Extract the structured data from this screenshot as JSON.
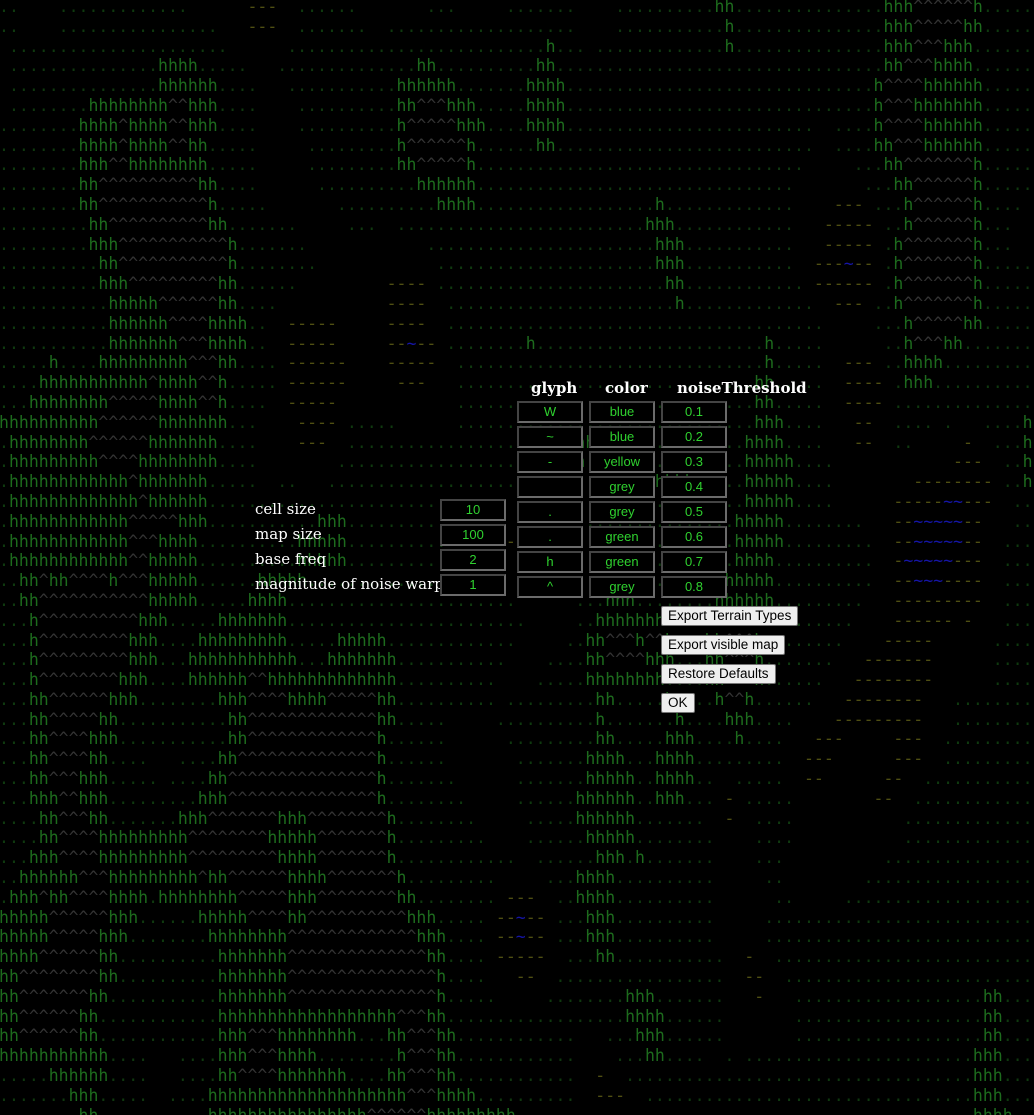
{
  "settings": {
    "cell_size": {
      "label": "cell size",
      "value": "10"
    },
    "map_size": {
      "label": "map size",
      "value": "100"
    },
    "base_freq": {
      "label": "base freq",
      "value": "2"
    },
    "noise_warping": {
      "label": "magnitude of noise warping",
      "value": "1"
    }
  },
  "terrain_table": {
    "headers": {
      "glyph": "glyph",
      "color": "color",
      "threshold": "noiseThreshold"
    },
    "rows": [
      {
        "glyph": "W",
        "color": "blue",
        "threshold": "0.1"
      },
      {
        "glyph": "~",
        "color": "blue",
        "threshold": "0.2"
      },
      {
        "glyph": "-",
        "color": "yellow",
        "threshold": "0.3"
      },
      {
        "glyph": "",
        "color": "grey",
        "threshold": "0.4"
      },
      {
        "glyph": ".",
        "color": "grey",
        "threshold": "0.5"
      },
      {
        "glyph": ".",
        "color": "green",
        "threshold": "0.6"
      },
      {
        "glyph": "h",
        "color": "green",
        "threshold": "0.7"
      },
      {
        "glyph": "^",
        "color": "grey",
        "threshold": "0.8"
      }
    ]
  },
  "buttons": {
    "export_terrain": "Export Terrain Types",
    "export_map": "Export visible map",
    "restore": "Restore Defaults",
    "ok": "OK"
  },
  "colors": {
    "background": "#000000",
    "input_text": "#2fd12f",
    "label_text": "#ffffff"
  }
}
